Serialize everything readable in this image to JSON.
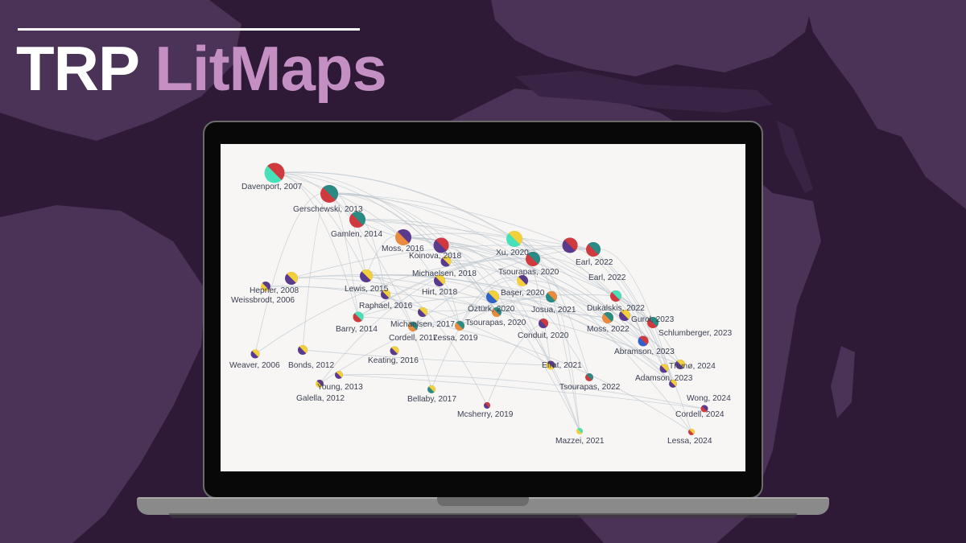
{
  "title": {
    "word1": "TRP",
    "word2": "LitMaps"
  },
  "colors": {
    "background": "#2e1a37",
    "title_accent": "#c48fc2",
    "edge": "#b9c5cd",
    "label": "#3a3f52",
    "node_palette": [
      "#d03a3f",
      "#2a8a84",
      "#47e0b8",
      "#5a3a8c",
      "#f4cf3c",
      "#e98a3d",
      "#3062c8"
    ]
  },
  "papers": [
    {
      "label": "Davenport, 2007",
      "c": [
        "#47e0b8",
        "#d03a3f"
      ]
    },
    {
      "label": "Gerschewski, 2013",
      "c": [
        "#d03a3f",
        "#2a8a84"
      ]
    },
    {
      "label": "Gamlen, 2014",
      "c": [
        "#d03a3f",
        "#2a8a84"
      ]
    },
    {
      "label": "Moss, 2016",
      "c": [
        "#e98a3d",
        "#5a3a8c"
      ]
    },
    {
      "label": "Koinova, 2018",
      "c": [
        "#5a3a8c",
        "#d03a3f"
      ]
    },
    {
      "label": "Xu, 2020",
      "c": [
        "#47e0b8",
        "#f4cf3c"
      ]
    },
    {
      "label": "Earl, 2022",
      "c": [
        "#5a3a8c",
        "#d03a3f"
      ]
    },
    {
      "label": "Earl, 2022",
      "c": [
        "#d03a3f",
        "#2a8a84"
      ]
    },
    {
      "label": "Michaelsen, 2018",
      "c": [
        "#5a3a8c",
        "#f4cf3c"
      ]
    },
    {
      "label": "Tsourapas, 2020",
      "c": [
        "#d03a3f",
        "#2a8a84"
      ]
    },
    {
      "label": "Hepner, 2008",
      "c": [
        "#5a3a8c",
        "#f4cf3c"
      ]
    },
    {
      "label": "Weissbrodt, 2006",
      "c": [
        "#f4cf3c",
        "#5a3a8c"
      ]
    },
    {
      "label": "Lewis, 2015",
      "c": [
        "#5a3a8c",
        "#f4cf3c"
      ]
    },
    {
      "label": "Hirt, 2018",
      "c": [
        "#5a3a8c",
        "#f4cf3c"
      ]
    },
    {
      "label": "Başer, 2020",
      "c": [
        "#f4cf3c",
        "#5a3a8c"
      ]
    },
    {
      "label": "Raphael, 2016",
      "c": [
        "#5a3a8c",
        "#f4cf3c"
      ]
    },
    {
      "label": "Öztürk, 2020",
      "c": [
        "#3062c8",
        "#f4cf3c"
      ]
    },
    {
      "label": "Josua, 2021",
      "c": [
        "#2a8a84",
        "#e98a3d"
      ]
    },
    {
      "label": "Dukalskis, 2022",
      "c": [
        "#d03a3f",
        "#47e0b8"
      ]
    },
    {
      "label": "Barry, 2014",
      "c": [
        "#d03a3f",
        "#47e0b8"
      ]
    },
    {
      "label": "Michaelsen, 2017",
      "c": [
        "#5a3a8c",
        "#f4cf3c"
      ]
    },
    {
      "label": "Tsourapas, 2020",
      "c": [
        "#e98a3d",
        "#2a8a84"
      ]
    },
    {
      "label": "Gurol, 2023",
      "c": [
        "#5a3a8c",
        "#f4cf3c"
      ]
    },
    {
      "label": "Moss, 2022",
      "c": [
        "#e98a3d",
        "#2a8a84"
      ]
    },
    {
      "label": "Schlumberger, 2023",
      "c": [
        "#d03a3f",
        "#2a8a84"
      ]
    },
    {
      "label": "Cordell, 2017",
      "c": [
        "#e98a3d",
        "#2a8a84"
      ]
    },
    {
      "label": "Lessa, 2019",
      "c": [
        "#e98a3d",
        "#2a8a84"
      ]
    },
    {
      "label": "Conduit, 2020",
      "c": [
        "#5a3a8c",
        "#d03a3f"
      ]
    },
    {
      "label": "Abramson, 2023",
      "c": [
        "#3062c8",
        "#d03a3f"
      ]
    },
    {
      "label": "Weaver, 2006",
      "c": [
        "#5a3a8c",
        "#f4cf3c"
      ]
    },
    {
      "label": "Bonds, 2012",
      "c": [
        "#5a3a8c",
        "#f4cf3c"
      ]
    },
    {
      "label": "Keating, 2016",
      "c": [
        "#5a3a8c",
        "#f4cf3c"
      ]
    },
    {
      "label": "Efrat, 2021",
      "c": [
        "#f4cf3c",
        "#5a3a8c"
      ]
    },
    {
      "label": "Thunø, 2024",
      "c": [
        "#5a3a8c",
        "#f4cf3c"
      ]
    },
    {
      "label": "Adamson, 2023",
      "c": [
        "#5a3a8c",
        "#f4cf3c"
      ]
    },
    {
      "label": "Young, 2013",
      "c": [
        "#5a3a8c",
        "#f4cf3c"
      ]
    },
    {
      "label": "Galella, 2012",
      "c": [
        "#f4cf3c",
        "#5a3a8c"
      ]
    },
    {
      "label": "Tsourapas, 2022",
      "c": [
        "#d03a3f",
        "#2a8a84"
      ]
    },
    {
      "label": "Wong, 2024",
      "c": [
        "#5a3a8c",
        "#f4cf3c"
      ]
    },
    {
      "label": "Bellaby, 2017",
      "c": [
        "#2a8a84",
        "#f4cf3c"
      ]
    },
    {
      "label": "Mcsherry, 2019",
      "c": [
        "#5a3a8c",
        "#d03a3f"
      ]
    },
    {
      "label": "Cordell, 2024",
      "c": [
        "#d03a3f",
        "#5a3a8c"
      ]
    },
    {
      "label": "Mazzei, 2021",
      "c": [
        "#f4cf3c",
        "#47e0b8"
      ]
    },
    {
      "label": "Lessa, 2024",
      "c": [
        "#d03a3f",
        "#f4cf3c"
      ]
    }
  ]
}
